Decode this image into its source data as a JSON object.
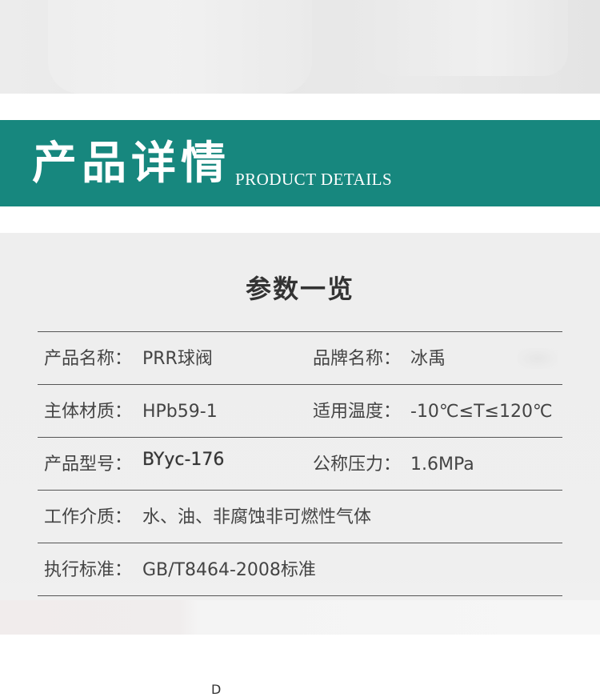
{
  "banner": {
    "title_cn": "产品详情",
    "title_en": "PRODUCT DETAILS"
  },
  "params": {
    "title": "参数一览",
    "rows": [
      {
        "label1": "产品名称：",
        "value1": "PRR球阀",
        "label2": "品牌名称：",
        "value2": "冰禹"
      },
      {
        "label1": "主体材质：",
        "value1": "HPb59-1",
        "label2": "适用温度：",
        "value2": "-10℃≤T≤120℃"
      },
      {
        "label1": "产品型号：",
        "value1": "BYyc-176",
        "label2": "公称压力：",
        "value2": "1.6MPa"
      },
      {
        "label1": "工作介质：",
        "value1": "水、油、非腐蚀非可燃性气体"
      },
      {
        "label1": "执行标准：",
        "value1": "GB/T8464-2008标准"
      }
    ]
  },
  "bottom_partial_text": "D",
  "colors": {
    "banner_bg": "#17877e",
    "params_bg": "#eeeeee",
    "rule": "#555555"
  }
}
